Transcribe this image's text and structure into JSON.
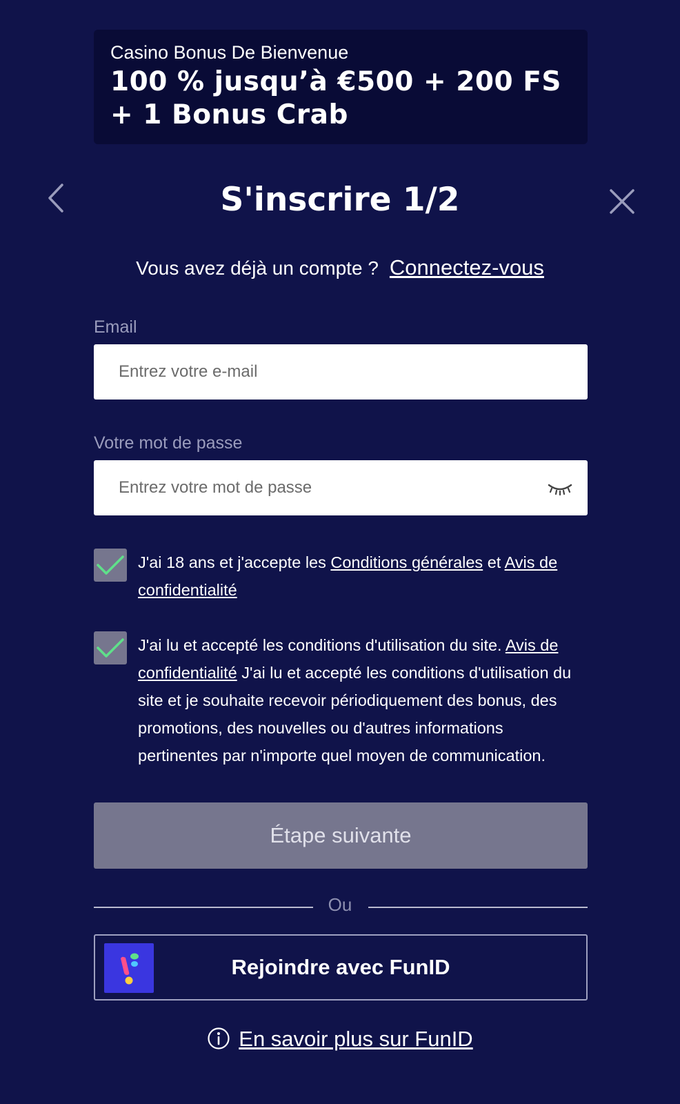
{
  "bonus": {
    "subtitle": "Casino Bonus De Bienvenue",
    "line1": "100 % jusqu’à €500 + 200 FS",
    "line2": "+ 1 Bonus Crab"
  },
  "header": {
    "title": "S'inscrire 1/2",
    "back_icon": "chevron-left-icon",
    "close_icon": "close-icon"
  },
  "login": {
    "prompt": "Vous avez déjà un compte ?",
    "link": "Connectez-vous"
  },
  "email": {
    "label": "Email",
    "placeholder": "Entrez votre e-mail",
    "value": ""
  },
  "password": {
    "label": "Votre mot de passe",
    "placeholder": "Entrez votre mot de passe",
    "value": "",
    "toggle_icon": "eye-closed-icon"
  },
  "consent1": {
    "checked": true,
    "text_before": "J'ai 18 ans et j'accepte les ",
    "link1": "Conditions générales",
    "text_mid": " et ",
    "link2": "Avis de confidentialité"
  },
  "consent2": {
    "checked": true,
    "text_before": "J'ai lu et accepté les conditions d'utilisation du site. ",
    "link": "Avis de confidentialité",
    "text_after": " J'ai lu et accepté les conditions d'utilisation du site et je souhaite recevoir périodiquement des bonus, des promotions, des nouvelles ou d'autres informations pertinentes par n'importe quel moyen de communication."
  },
  "next_button": "Étape suivante",
  "divider": "Ou",
  "funid": {
    "label": "Rejoindre avec FunID",
    "logo": "funid-logo"
  },
  "learn_more": {
    "icon": "info-icon",
    "link": "En savoir plus sur FunID"
  },
  "colors": {
    "background": "#10134a",
    "banner": "#090b36",
    "disabled_button": "#76768e",
    "checkmark": "#5fe08a",
    "funid_brand": "#3a36e0"
  }
}
